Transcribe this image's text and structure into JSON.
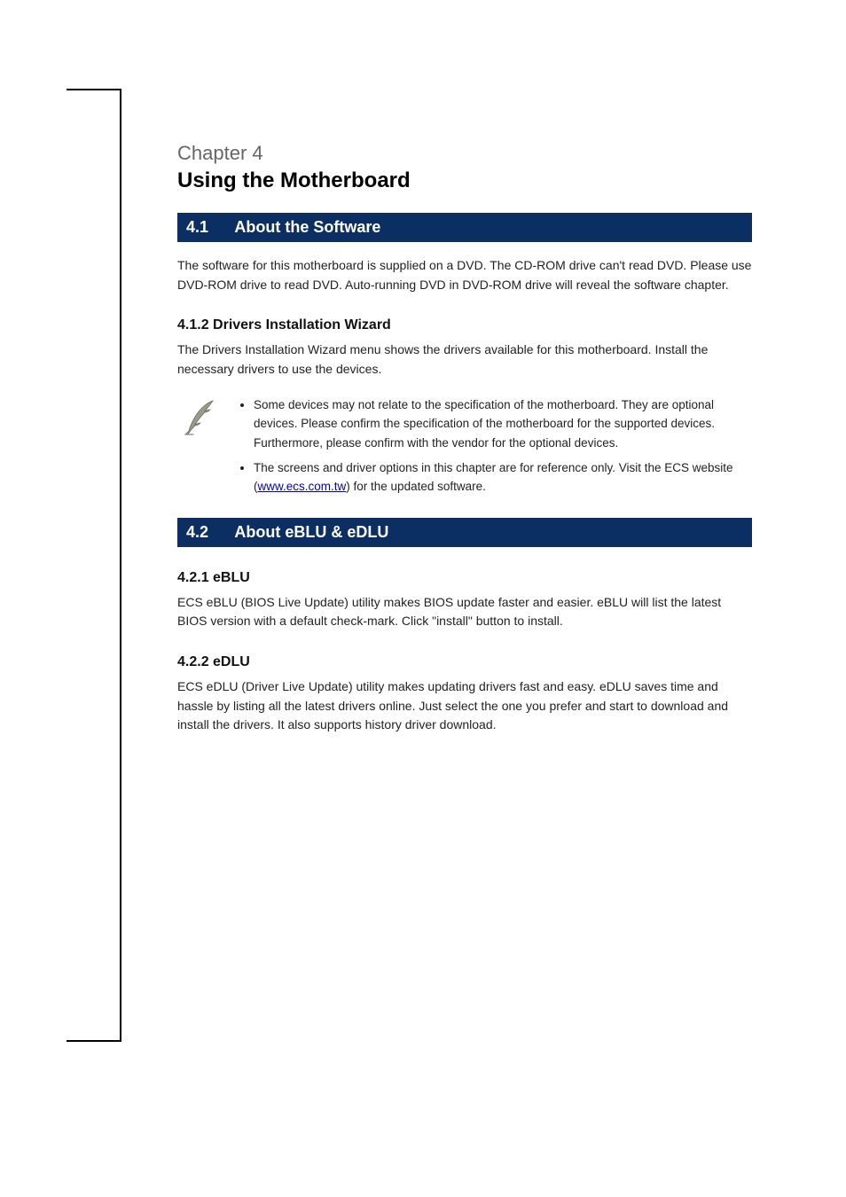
{
  "chapter": {
    "label": "Chapter 4",
    "title": "Using the Motherboard"
  },
  "section41": {
    "number": "4.1",
    "title": "About the Software",
    "para1": "The software for this motherboard is supplied on a DVD. The CD-ROM drive can't read DVD. Please use DVD-ROM drive to read DVD. Auto-running DVD in DVD-ROM drive will reveal the software chapter."
  },
  "section412": {
    "title": "4.1.2 Drivers Installation Wizard",
    "para1": "The Drivers Installation Wizard menu shows the drivers available for this motherboard. Install the necessary drivers to use the devices."
  },
  "note": {
    "bullet1a": "Some devices may not relate to the specification of the motherboard. They are optional devices. Please confirm the specification of the motherboard for the supported devices. Furthermore, please confirm with the vendor for the optional devices.",
    "bullet1b": "The screens and driver options in this chapter are for reference only. Visit the ECS website (",
    "link_text": "www.ecs.com.tw",
    "bullet1c": ") for the updated software."
  },
  "section42": {
    "number": "4.2",
    "title": "About eBLU & eDLU",
    "subhead1": "4.2.1 eBLU",
    "para1": "ECS eBLU (BIOS Live Update) utility makes BIOS update faster and easier. eBLU will list the latest BIOS version with a default check-mark. Click \"install\" button to install.",
    "subhead2": "4.2.2 eDLU",
    "para2": "ECS eDLU (Driver Live Update) utility makes updating drivers fast and easy. eDLU saves time and hassle by listing all the latest drivers online. Just select the one you prefer and start to download and install the drivers. It also supports history driver download."
  }
}
